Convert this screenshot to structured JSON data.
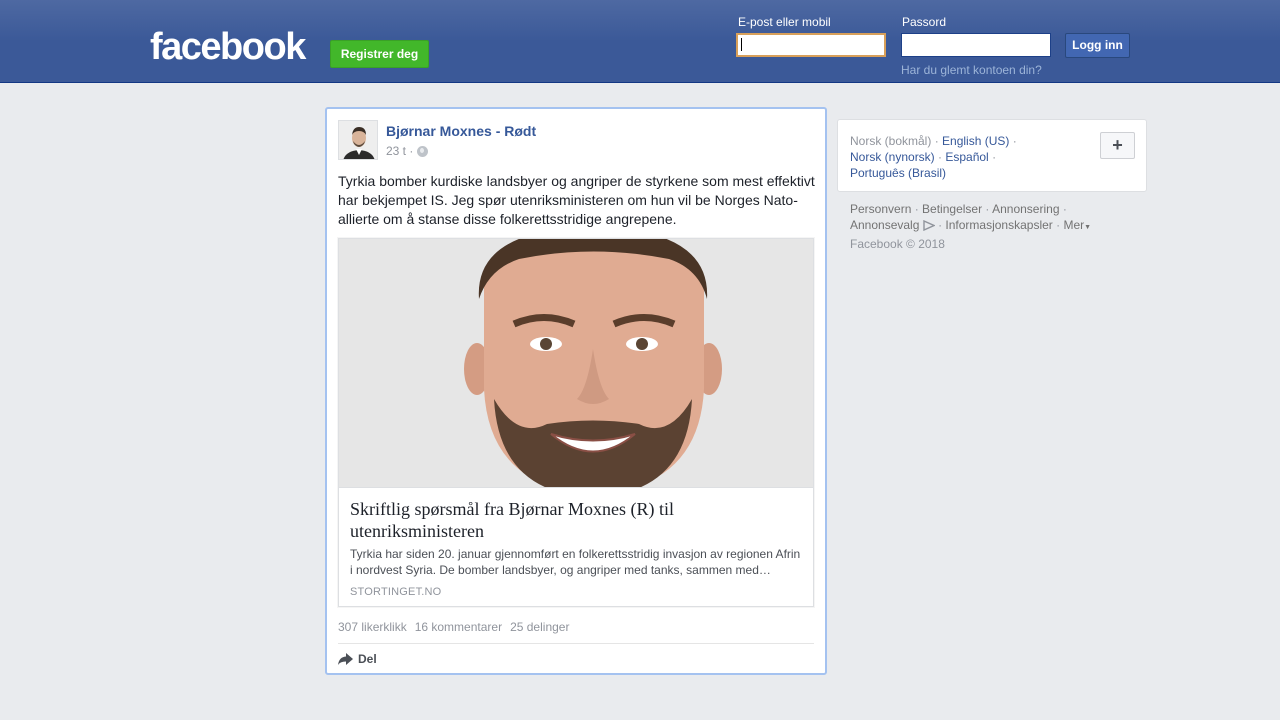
{
  "header": {
    "logo": "facebook",
    "register_button": "Registrer deg",
    "email_label": "E-post eller mobil",
    "password_label": "Passord",
    "email_value": "",
    "password_value": "",
    "login_button": "Logg inn",
    "forgot_link": "Har du glemt kontoen din?"
  },
  "post": {
    "author": "Bjørnar Moxnes - Rødt",
    "time": "23 t ·",
    "text": "Tyrkia bomber kurdiske landsbyer og angriper de styrkene som mest effektivt har bekjempet IS. Jeg spør utenriksministeren om hun vil be Norges Nato-allierte om å stanse disse folkerettsstridige angrepene.",
    "link": {
      "title": "Skriftlig spørsmål fra Bjørnar Moxnes (R) til utenriksministeren",
      "description": "Tyrkia har siden 20. januar gjennomført en folkerettsstridig invasjon av regionen Afrin i nordvest Syria. De bomber landsbyer, og angriper med tanks, sammen med…",
      "domain": "STORTINGET.NO"
    },
    "stats": {
      "likes": "307 likerklikk",
      "comments": "16 kommentarer",
      "shares": "25 delinger"
    },
    "share_label": "Del"
  },
  "languages": {
    "current": "Norsk (bokmål)",
    "options": [
      "English (US)",
      "Norsk (nynorsk)",
      "Español",
      "Português (Brasil)"
    ]
  },
  "footer": {
    "privacy": "Personvern",
    "terms": "Betingelser",
    "advertising": "Annonsering",
    "ad_choices": "Annonsevalg",
    "cookies": "Informasjonskapsler",
    "more": "Mer",
    "copyright": "Facebook © 2018"
  },
  "colors": {
    "brand_blue": "#3b5998",
    "register_green": "#42b72a",
    "link_blue": "#365899"
  }
}
